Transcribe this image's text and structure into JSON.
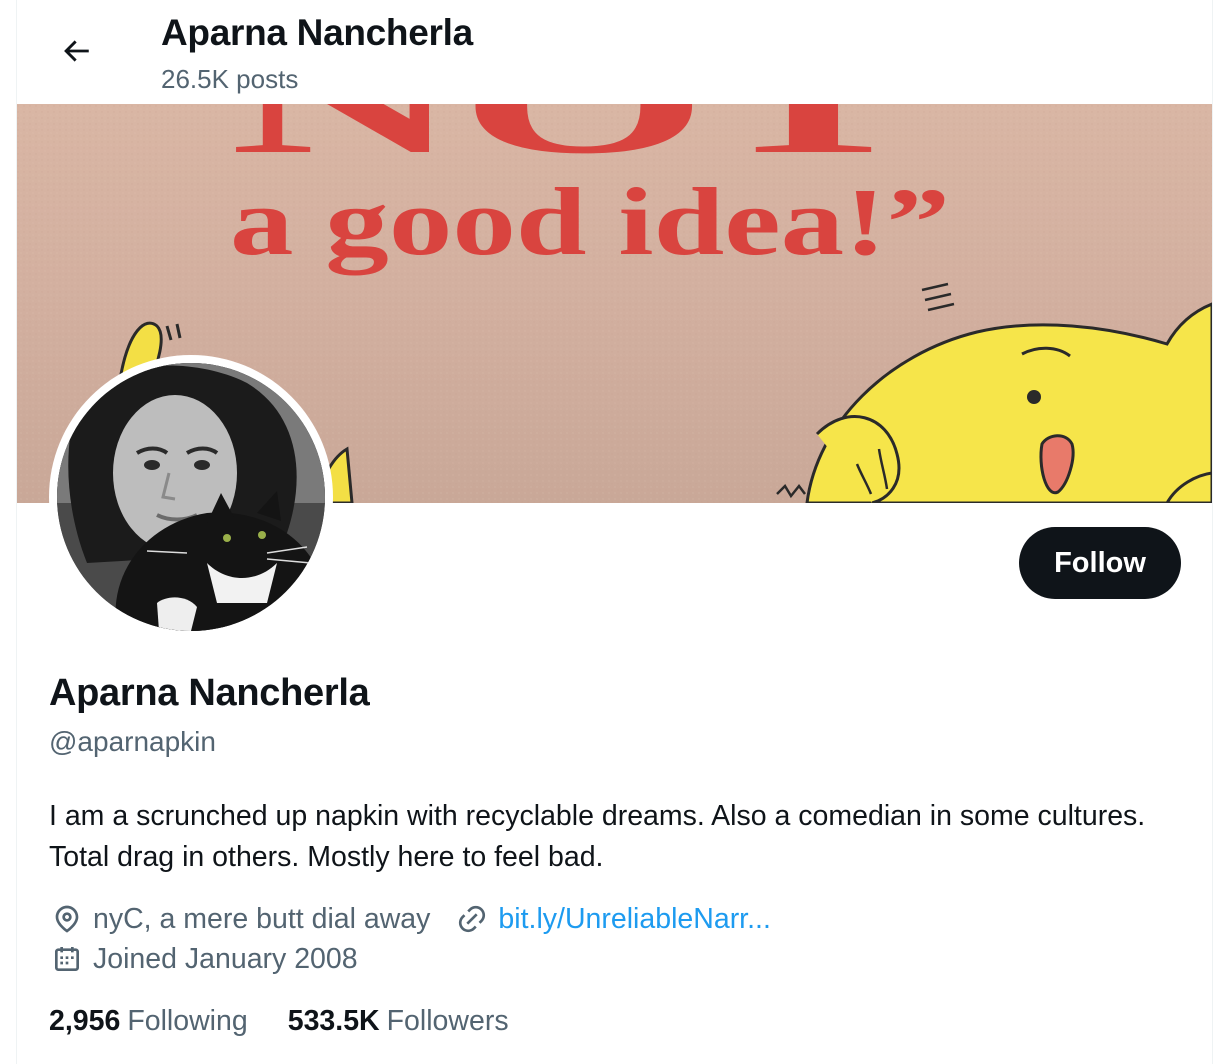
{
  "header": {
    "title": "Aparna Nancherla",
    "posts_count": "26.5K posts"
  },
  "banner": {
    "text_line1": "NOT",
    "text_line2": "a good idea!”"
  },
  "profile": {
    "display_name": "Aparna Nancherla",
    "handle": "@aparnapkin",
    "bio": "I am a scrunched up napkin with recyclable dreams. Also a comedian in some cultures. Total drag in others. Mostly here to feel bad.",
    "location": "nyC, a mere butt dial away",
    "website": "bit.ly/UnreliableNarr...",
    "joined": "Joined January 2008"
  },
  "actions": {
    "follow_label": "Follow"
  },
  "stats": {
    "following_count": "2,956",
    "following_label": "Following",
    "followers_count": "533.5K",
    "followers_label": "Followers"
  },
  "colors": {
    "text_primary": "#0f1419",
    "text_secondary": "#536471",
    "link": "#1d9bf0",
    "button_bg": "#0f1419",
    "banner_text": "#d9443f",
    "banner_character": "#f6e54a"
  },
  "icons": {
    "back": "arrow-left-icon",
    "location": "location-pin-icon",
    "website": "link-icon",
    "joined": "calendar-icon"
  }
}
